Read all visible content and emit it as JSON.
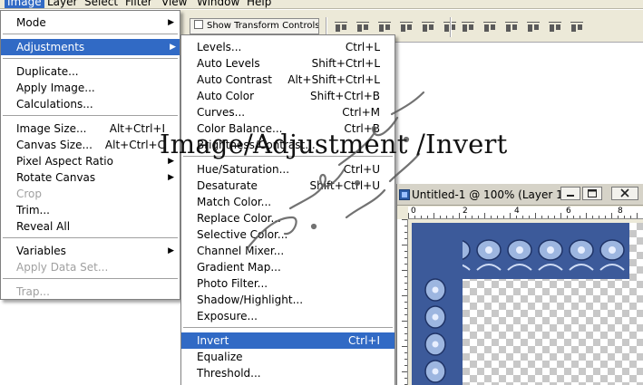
{
  "menubar": {
    "items": [
      "Image",
      "Layer",
      "Select",
      "Filter",
      "View",
      "Window",
      "Help"
    ],
    "active": "Image"
  },
  "options_bar": {
    "show_transform_controls": "Show Transform Controls",
    "show_transform_checked": false,
    "icons": [
      "align-top-edges-icon",
      "align-vertical-centers-icon",
      "align-bottom-edges-icon",
      "align-left-edges-icon",
      "align-horizontal-centers-icon",
      "align-right-edges-icon",
      "distribute-top-edges-icon",
      "distribute-vertical-centers-icon",
      "distribute-bottom-edges-icon",
      "distribute-left-edges-icon",
      "distribute-horizontal-centers-icon",
      "distribute-right-edges-icon"
    ]
  },
  "image_menu": {
    "items": [
      {
        "label": "Mode",
        "submenu": true
      },
      {
        "label": "Adjustments",
        "submenu": true,
        "selected": true
      },
      {
        "label": "Duplicate..."
      },
      {
        "label": "Apply Image..."
      },
      {
        "label": "Calculations..."
      },
      {
        "label": "Image Size...",
        "shortcut": "Alt+Ctrl+I"
      },
      {
        "label": "Canvas Size...",
        "shortcut": "Alt+Ctrl+C"
      },
      {
        "label": "Pixel Aspect Ratio",
        "submenu": true
      },
      {
        "label": "Rotate Canvas",
        "submenu": true
      },
      {
        "label": "Crop",
        "disabled": true
      },
      {
        "label": "Trim..."
      },
      {
        "label": "Reveal All"
      },
      {
        "label": "Variables",
        "submenu": true
      },
      {
        "label": "Apply Data Set...",
        "disabled": true
      },
      {
        "label": "Trap...",
        "disabled": true
      }
    ]
  },
  "adjustments_menu": {
    "items": [
      {
        "label": "Levels...",
        "shortcut": "Ctrl+L"
      },
      {
        "label": "Auto Levels",
        "shortcut": "Shift+Ctrl+L"
      },
      {
        "label": "Auto Contrast",
        "shortcut": "Alt+Shift+Ctrl+L"
      },
      {
        "label": "Auto Color",
        "shortcut": "Shift+Ctrl+B"
      },
      {
        "label": "Curves...",
        "shortcut": "Ctrl+M"
      },
      {
        "label": "Color Balance...",
        "shortcut": "Ctrl+B"
      },
      {
        "label": "Brightness/Contrast...",
        "shortcut": ""
      },
      {
        "label": "Hue/Saturation...",
        "shortcut": "Ctrl+U"
      },
      {
        "label": "Desaturate",
        "shortcut": "Shift+Ctrl+U"
      },
      {
        "label": "Match Color...",
        "shortcut": ""
      },
      {
        "label": "Replace Color...",
        "shortcut": ""
      },
      {
        "label": "Selective Color...",
        "shortcut": ""
      },
      {
        "label": "Channel Mixer...",
        "shortcut": ""
      },
      {
        "label": "Gradient Map...",
        "shortcut": ""
      },
      {
        "label": "Photo Filter...",
        "shortcut": ""
      },
      {
        "label": "Shadow/Highlight...",
        "shortcut": ""
      },
      {
        "label": "Exposure...",
        "shortcut": ""
      },
      {
        "label": "Invert",
        "shortcut": "Ctrl+I",
        "selected": true
      },
      {
        "label": "Equalize",
        "shortcut": ""
      },
      {
        "label": "Threshold...",
        "shortcut": ""
      }
    ]
  },
  "document": {
    "title": "Untitled-1 @ 100% (Layer 1, ...",
    "ruler_labels": [
      "0",
      "2",
      "4",
      "6",
      "8"
    ]
  },
  "overlay": {
    "caption": "Image/Adjustment /Invert"
  },
  "colors": {
    "menu_highlight": "#316ac5",
    "frame_blue": "#3c5a9a"
  }
}
